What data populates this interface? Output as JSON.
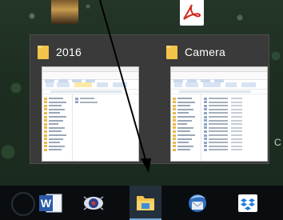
{
  "desktop": {
    "icons": [
      "photo-shortcut-icon",
      "pdf-shortcut-icon"
    ]
  },
  "taskbar_preview": {
    "thumbnails": [
      {
        "title": "2016",
        "icon": "folder-icon"
      },
      {
        "title": "Camera",
        "icon": "folder-icon"
      }
    ]
  },
  "taskbar": {
    "buttons": [
      {
        "app": "word",
        "label": "W",
        "icon": "word-icon"
      },
      {
        "app": "eye-app",
        "icon": "eye-app-icon"
      },
      {
        "app": "file-explorer",
        "icon": "file-explorer-icon",
        "active": true
      },
      {
        "app": "thunderbird",
        "icon": "thunderbird-icon"
      },
      {
        "app": "dropbox",
        "icon": "dropbox-icon"
      }
    ]
  },
  "annotation": {
    "type": "arrow",
    "color": "#000000"
  },
  "colors": {
    "taskbar": "#0a0d10",
    "popup": "#3a3a3a",
    "folder": "#f3c44a",
    "active_indicator": "#6fa6d6"
  }
}
